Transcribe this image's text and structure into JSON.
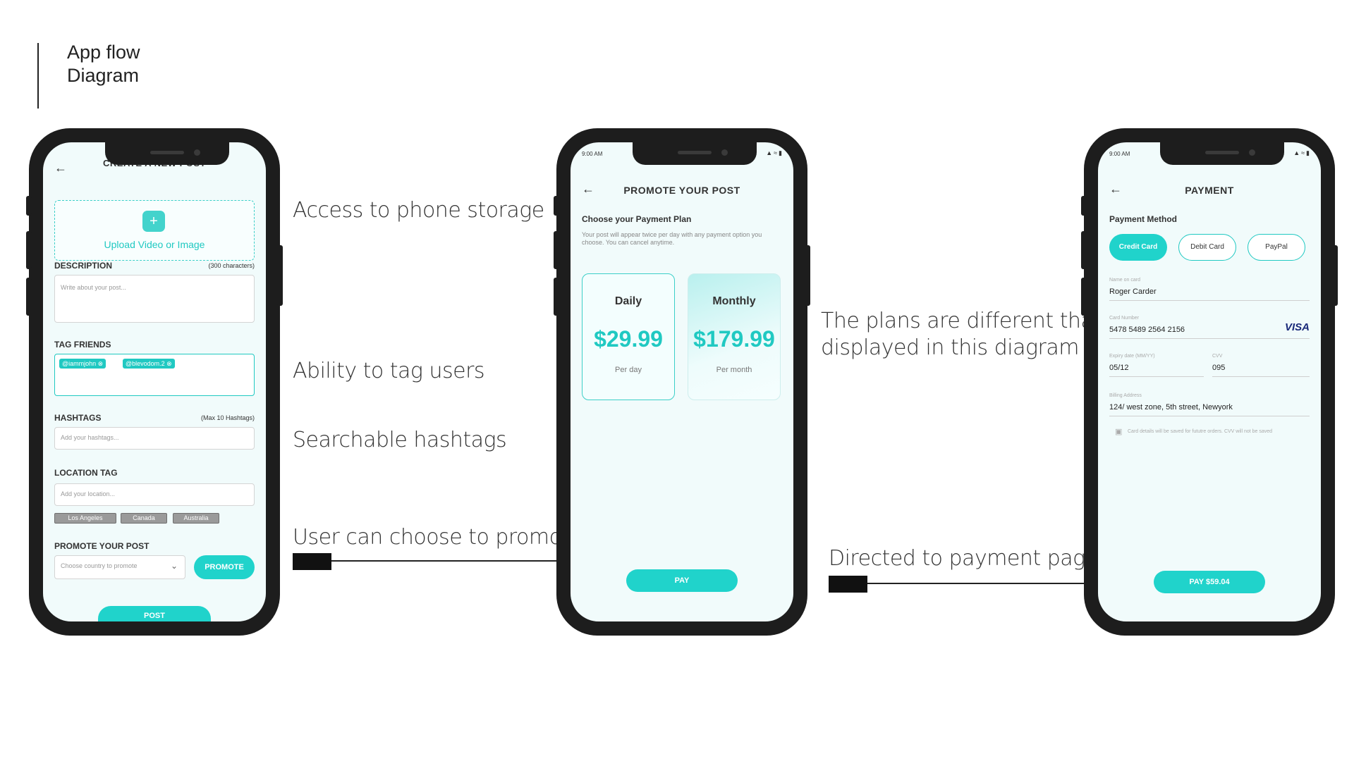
{
  "header": {
    "title_line1": "App flow",
    "title_line2": "Diagram"
  },
  "annotations": {
    "storage": "Access to phone storage",
    "tag": "Ability to tag users",
    "hashtags": "Searchable hashtags",
    "promote": "User can choose to promote",
    "plans": "The plans are different than",
    "plans_line2": "displayed in this diagram",
    "payment": "Directed to payment page"
  },
  "screen1": {
    "title": "CREATE A NEW POST",
    "upload_label": "Upload Video or Image",
    "description_label": "DESCRIPTION",
    "description_limit": "(300 characters)",
    "description_placeholder": "Write about your post...",
    "tag_label": "TAG FRIENDS",
    "tags": [
      "@iammjohn",
      "@blevodom.2"
    ],
    "hashtags_label": "HASHTAGS",
    "hashtags_limit": "(Max 10 Hashtags)",
    "hashtags_placeholder": "Add your hashtags...",
    "location_label": "LOCATION TAG",
    "location_placeholder": "Add your location...",
    "locations": [
      "Los Angeles",
      "Canada",
      "Australia"
    ],
    "promote_label": "PROMOTE YOUR POST",
    "country_placeholder": "Choose country to promote",
    "promote_button": "PROMOTE",
    "post_button": "POST"
  },
  "screen2": {
    "status_time": "9:00 AM",
    "title": "PROMOTE YOUR POST",
    "plan_heading": "Choose your Payment Plan",
    "plan_desc": "Your post will appear twice per day with any payment option you choose. You can cancel anytime.",
    "plans": [
      {
        "name": "Daily",
        "price": "$29.99",
        "per": "Per day"
      },
      {
        "name": "Monthly",
        "price": "$179.99",
        "per": "Per month"
      }
    ],
    "pay_button": "PAY"
  },
  "screen3": {
    "status_time": "9:00 AM",
    "title": "PAYMENT",
    "method_label": "Payment Method",
    "methods": [
      "Credit Card",
      "Debit Card",
      "PayPal"
    ],
    "name_label": "Name on card",
    "name_value": "Roger Carder",
    "card_label": "Card Number",
    "card_value": "5478 5489 2564 2156",
    "card_brand": "VISA",
    "expiry_label": "Expiry date (MM/YY)",
    "expiry_value": "05/12",
    "cvv_label": "CVV",
    "cvv_value": "095",
    "billing_label": "Billing Address",
    "billing_value": "124/ west zone, 5th street, Newyork",
    "note": "Card details will be saved for fututre orders. CVV will not be saved",
    "pay_button": "PAY $59.04"
  },
  "colors": {
    "accent": "#20c9c2",
    "phone": "#1d1d1d",
    "screen_bg": "#f1fbfb"
  }
}
